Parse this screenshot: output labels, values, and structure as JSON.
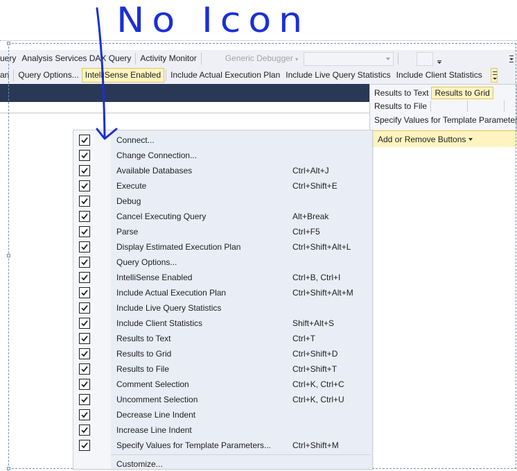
{
  "annotation": {
    "text": "No Icon"
  },
  "toolbar1": {
    "items": [
      "uery",
      "Analysis Services DAX Query",
      "Activity Monitor"
    ],
    "debugger_label": "Generic Debugger"
  },
  "toolbar2": {
    "items": [
      {
        "label": "an",
        "active": false
      },
      {
        "label": "Query Options...",
        "active": false
      },
      {
        "label": "IntelliSense Enabled",
        "active": true
      },
      {
        "label": "Include Actual Execution Plan",
        "active": false
      },
      {
        "label": "Include Live Query Statistics",
        "active": false
      },
      {
        "label": "Include Client Statistics",
        "active": false
      }
    ]
  },
  "overflow_panel": {
    "results_to_text": "Results to Text",
    "results_to_grid": "Results to Grid",
    "results_to_file": "Results to File",
    "specify_values": "Specify Values for Template Parameters",
    "add_remove": "Add or Remove Buttons"
  },
  "menu": {
    "items": [
      {
        "label": "Connect...",
        "shortcut": "",
        "checked": true
      },
      {
        "label": "Change Connection...",
        "shortcut": "",
        "checked": true
      },
      {
        "label": "Available Databases",
        "shortcut": "Ctrl+Alt+J",
        "checked": true
      },
      {
        "label": "Execute",
        "shortcut": "Ctrl+Shift+E",
        "checked": true
      },
      {
        "label": "Debug",
        "shortcut": "",
        "checked": true
      },
      {
        "label": "Cancel Executing Query",
        "shortcut": "Alt+Break",
        "checked": true
      },
      {
        "label": "Parse",
        "shortcut": "Ctrl+F5",
        "checked": true
      },
      {
        "label": "Display Estimated Execution Plan",
        "shortcut": "Ctrl+Shift+Alt+L",
        "checked": true
      },
      {
        "label": "Query Options...",
        "shortcut": "",
        "checked": true
      },
      {
        "label": "IntelliSense Enabled",
        "shortcut": "Ctrl+B, Ctrl+I",
        "checked": true
      },
      {
        "label": "Include Actual Execution Plan",
        "shortcut": "Ctrl+Shift+Alt+M",
        "checked": true
      },
      {
        "label": "Include Live Query Statistics",
        "shortcut": "",
        "checked": true
      },
      {
        "label": "Include Client Statistics",
        "shortcut": "Shift+Alt+S",
        "checked": true
      },
      {
        "label": "Results to Text",
        "shortcut": "Ctrl+T",
        "checked": true
      },
      {
        "label": "Results to Grid",
        "shortcut": "Ctrl+Shift+D",
        "checked": true
      },
      {
        "label": "Results to File",
        "shortcut": "Ctrl+Shift+T",
        "checked": true
      },
      {
        "label": "Comment Selection",
        "shortcut": "Ctrl+K, Ctrl+C",
        "checked": true
      },
      {
        "label": "Uncomment Selection",
        "shortcut": "Ctrl+K, Ctrl+U",
        "checked": true
      },
      {
        "label": "Decrease Line Indent",
        "shortcut": "",
        "checked": true
      },
      {
        "label": "Increase Line Indent",
        "shortcut": "",
        "checked": true
      },
      {
        "label": "Specify Values for Template Parameters...",
        "shortcut": "Ctrl+Shift+M",
        "checked": true
      }
    ],
    "customize": "Customize..."
  },
  "colors": {
    "annotation": "#1b2fd6",
    "highlight": "#fdf4bf",
    "highlight_border": "#e5c365",
    "dark_band": "#293955"
  }
}
